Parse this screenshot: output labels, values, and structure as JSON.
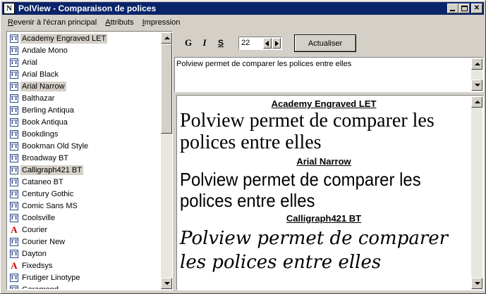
{
  "window": {
    "title": "PolView - Comparaison de polices",
    "icon_letter": "N",
    "controls": [
      "minimize-icon",
      "maximize-icon",
      "close-icon"
    ],
    "close_glyph": "✕"
  },
  "menu": {
    "items": [
      {
        "mnemonic": "R",
        "rest": "evenir à l'écran principal"
      },
      {
        "mnemonic": "A",
        "rest": "ttributs"
      },
      {
        "mnemonic": "I",
        "rest": "mpression"
      }
    ]
  },
  "fontlist": {
    "items": [
      {
        "label": "Academy Engraved LET",
        "type": "truetype",
        "selected": true
      },
      {
        "label": "Andale Mono",
        "type": "truetype",
        "selected": false
      },
      {
        "label": "Arial",
        "type": "truetype",
        "selected": false
      },
      {
        "label": "Arial Black",
        "type": "truetype",
        "selected": false
      },
      {
        "label": "Arial Narrow",
        "type": "truetype",
        "selected": true
      },
      {
        "label": "Balthazar",
        "type": "truetype",
        "selected": false
      },
      {
        "label": "Berling Antiqua",
        "type": "truetype",
        "selected": false
      },
      {
        "label": "Book Antiqua",
        "type": "truetype",
        "selected": false
      },
      {
        "label": "Bookdings",
        "type": "truetype",
        "selected": false
      },
      {
        "label": "Bookman Old Style",
        "type": "truetype",
        "selected": false
      },
      {
        "label": "Broadway BT",
        "type": "truetype",
        "selected": false
      },
      {
        "label": "Calligraph421 BT",
        "type": "truetype",
        "selected": true
      },
      {
        "label": "Cataneo BT",
        "type": "truetype",
        "selected": false
      },
      {
        "label": "Century Gothic",
        "type": "truetype",
        "selected": false
      },
      {
        "label": "Comic Sans MS",
        "type": "truetype",
        "selected": false
      },
      {
        "label": "Coolsville",
        "type": "truetype",
        "selected": false
      },
      {
        "label": "Courier",
        "type": "raster",
        "selected": false
      },
      {
        "label": "Courier New",
        "type": "truetype",
        "selected": false
      },
      {
        "label": "Dayton",
        "type": "truetype",
        "selected": false
      },
      {
        "label": "Fixedsys",
        "type": "raster",
        "selected": false
      },
      {
        "label": "Frutiger Linotype",
        "type": "truetype",
        "selected": false
      },
      {
        "label": "Garamond",
        "type": "truetype",
        "selected": false
      }
    ],
    "icon_truetype": "TT",
    "icon_raster": "A"
  },
  "toolbar": {
    "bold": "G",
    "italic": "I",
    "underline": "S",
    "size_value": "22",
    "refresh_label": "Actualiser"
  },
  "sample_text": "Polview permet de comparer les polices entre elles",
  "preview": {
    "blocks": [
      {
        "heading": "Academy Engraved LET",
        "text": "Polview permet de comparer les polices entre elles"
      },
      {
        "heading": "Arial Narrow",
        "text": "Polview permet de comparer les polices entre elles"
      },
      {
        "heading": "Calligraph421 BT",
        "text": "Polview permet de comparer les polices entre elles"
      }
    ]
  }
}
